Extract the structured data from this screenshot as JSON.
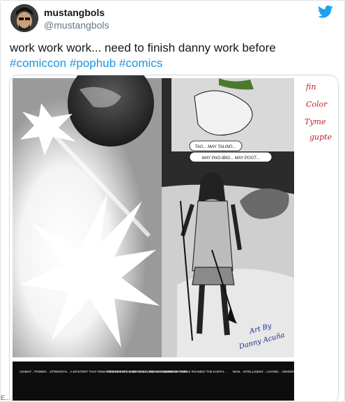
{
  "author": {
    "name": "mustangbols",
    "handle": "@mustangbols"
  },
  "tweet": {
    "text": "work work work... need to finish danny work before",
    "hashtags": [
      "#comiccon",
      "#pophub",
      "#comics"
    ]
  },
  "media": {
    "speech_bubble_1": "TAO... MAY TALINO...",
    "speech_bubble_2": "MAY PAG-IBIG... MAY POOT...",
    "margin_note": [
      "fin",
      "Color",
      "Tyme",
      "gupte"
    ],
    "signature_line1": "Art By",
    "signature_line2": "Danny Acuña",
    "captions": [
      "AGIMAT... POWER... STRENGTH... A MYSTERY THAT REMAINED UNEXPLAINED SINCE THE BEGINNING OF TIME...",
      "POWER THAT IS BEYOND UNDERSTANDING...",
      "CREATURES ROAMED THE EARTH...",
      "MAN... INTELLIGENT... LOVING... VENGEF..."
    ]
  },
  "corner_text": "E...",
  "colors": {
    "link": "#1b95e0",
    "twitter_blue": "#1da1f2",
    "note_red": "#c0202c"
  }
}
